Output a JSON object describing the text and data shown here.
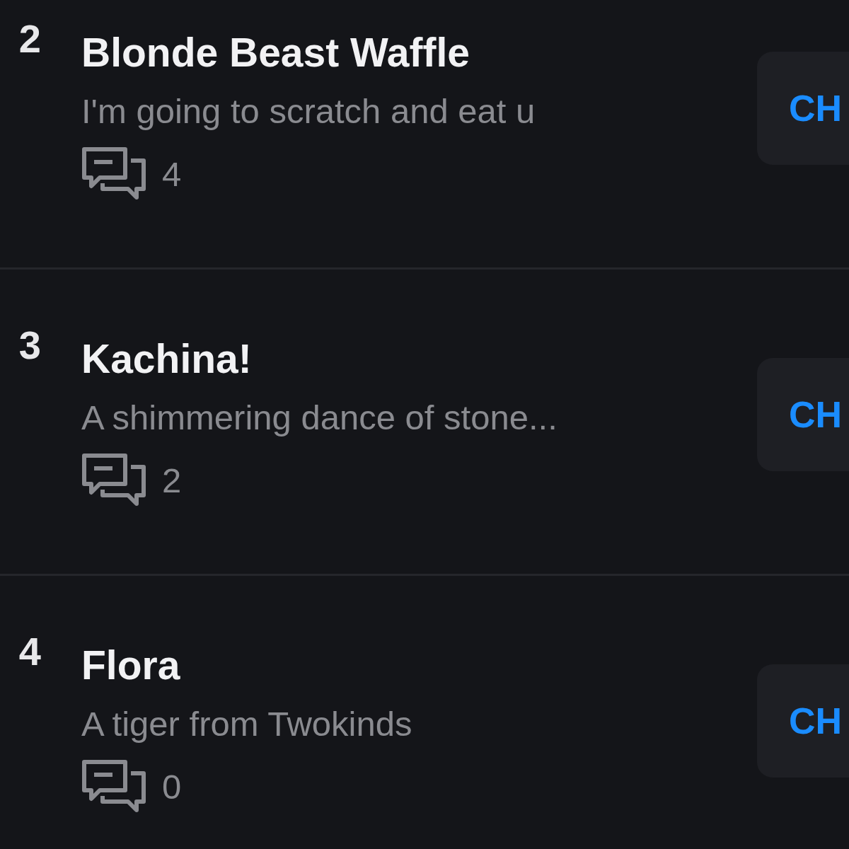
{
  "rows": [
    {
      "rank": "2",
      "title": "Blonde Beast Waffle",
      "description": "I'm going to scratch and eat u",
      "comments": "4",
      "button": "CH"
    },
    {
      "rank": "3",
      "title": "Kachina!",
      "description": "A shimmering dance of stone...",
      "comments": "2",
      "button": "CH"
    },
    {
      "rank": "4",
      "title": "Flora",
      "description": "A tiger from Twokinds",
      "comments": "0",
      "button": "CH"
    }
  ]
}
